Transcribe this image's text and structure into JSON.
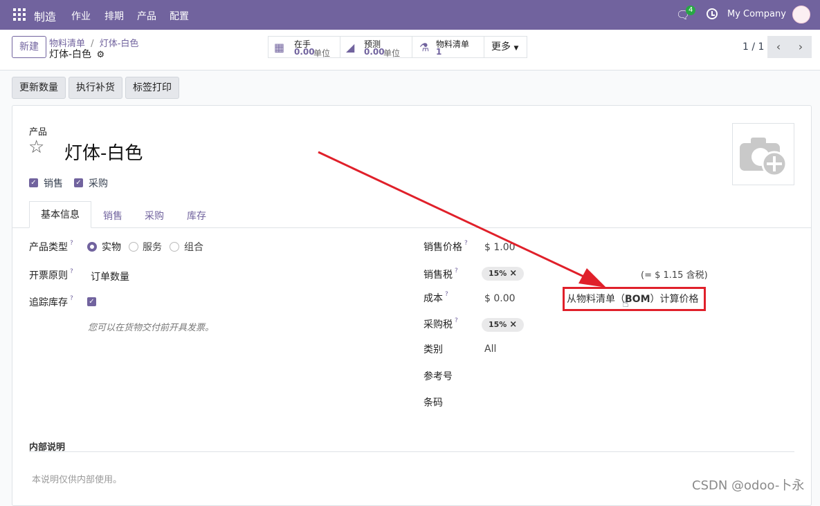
{
  "topbar": {
    "app": "制造",
    "menu": [
      "作业",
      "排期",
      "产品",
      "配置"
    ],
    "chat_badge": "4",
    "company": "My Company"
  },
  "control": {
    "new_label": "新建",
    "breadcrumb_parent": "物料清单",
    "breadcrumb_sep": "/",
    "breadcrumb_current": "灯体-白色",
    "record_name": "灯体-白色",
    "stats": [
      {
        "label": "在手",
        "value": "0.00",
        "unit": "单位"
      },
      {
        "label": "预测",
        "value": "0.00",
        "unit": "单位"
      },
      {
        "label": "物料清单",
        "value": "1"
      }
    ],
    "more_label": "更多",
    "pager": "1 / 1"
  },
  "actions": [
    "更新数量",
    "执行补货",
    "标签打印"
  ],
  "form": {
    "product_label": "产品",
    "product_name": "灯体-白色",
    "sale_ok": "销售",
    "purchase_ok": "采购",
    "tabs": [
      "基本信息",
      "销售",
      "采购",
      "库存"
    ],
    "left": {
      "type_label": "产品类型",
      "type_options": [
        "实物",
        "服务",
        "组合"
      ],
      "invoice_label": "开票原则",
      "invoice_value": "订单数量",
      "track_label": "追踪库存",
      "hint": "您可以在货物交付前开具发票。"
    },
    "right": {
      "price_label": "销售价格",
      "price_value": "$ 1.00",
      "tax_label": "销售税",
      "tax_tag": "15%",
      "tax_included": "(= $ 1.15 含税)",
      "cost_label": "成本",
      "cost_value": "$ 0.00",
      "bom_link_before": "从物料清单（",
      "bom_link_bold": "BOM",
      "bom_link_after": "）计算价格",
      "ptax_label": "采购税",
      "ptax_tag": "15%",
      "categ_label": "类别",
      "categ_value": "All",
      "ref_label": "参考号",
      "barcode_label": "条码"
    },
    "internal_label": "内部说明",
    "internal_placeholder": "本说明仅供内部使用。"
  },
  "watermark": "CSDN @odoo-卜永",
  "colors": {
    "brand": "#71639e",
    "highlight": "#e0202a"
  }
}
